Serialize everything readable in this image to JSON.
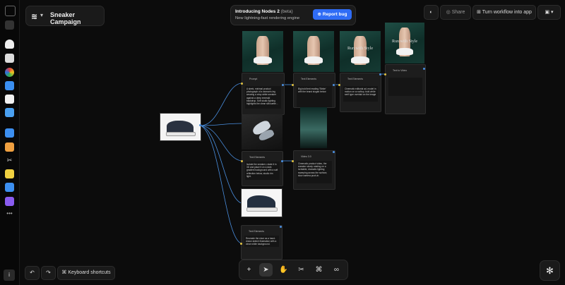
{
  "project": {
    "logo": "≋",
    "name": "Sneaker Campaign"
  },
  "banner": {
    "title": "Introducing Nodes 2",
    "badge": "(beta)",
    "subtitle": "New lightning-fast rendering engine",
    "button": "Report bug"
  },
  "topbar": {
    "share": "Share",
    "turn_workflow": "Turn workflow into app"
  },
  "bottombar": {
    "keyboard_shortcuts": "Keyboard shortcuts"
  },
  "rail_icons": [
    "layers-icon",
    "brush-icon",
    "color-icon",
    "image-icon",
    "square-icon",
    "folder-icon",
    "docs-icon",
    "history-icon",
    "tools-icon",
    "star-icon",
    "arrow-icon",
    "text-icon",
    "more-icon"
  ],
  "nodes": {
    "n1": {
      "title": "Prompt",
      "text": "A sleek, minimal product photograph of a woman's leg wearing a crisp white sneaker against a deep emerald backdrop. Soft studio lighting highlights the clean silhouette..."
    },
    "n2": {
      "title": "Text Elements",
      "text": "Big bold text reading 'Stride' with the brand slogan below"
    },
    "n3": {
      "title": "Text Elements",
      "text": "Cinematic editorial ad, model in motion on a rooftop, bold white serif type overlaid on the image"
    },
    "n4": {
      "title": "Text to Video",
      "text": ""
    },
    "n5": {
      "title": "Text Elements",
      "text": "Isolate the sneaker, rotate it in 3D and place it on a dark gradient background with a soft reflection below, studio rim light."
    },
    "n6": {
      "title": "Video 3.0",
      "text": "Cinematic product video, the sneaker slowly rotating on a turntable, dramatic lighting sweeping across the surface, slow camera push-in."
    },
    "n7": {
      "title": "Text Elements",
      "text": "Recreate the shoe as a hand-drawn sketch illustration with a clean white background."
    }
  },
  "image_labels": {
    "img2": "Run with Style",
    "img3": "Run with Style"
  }
}
